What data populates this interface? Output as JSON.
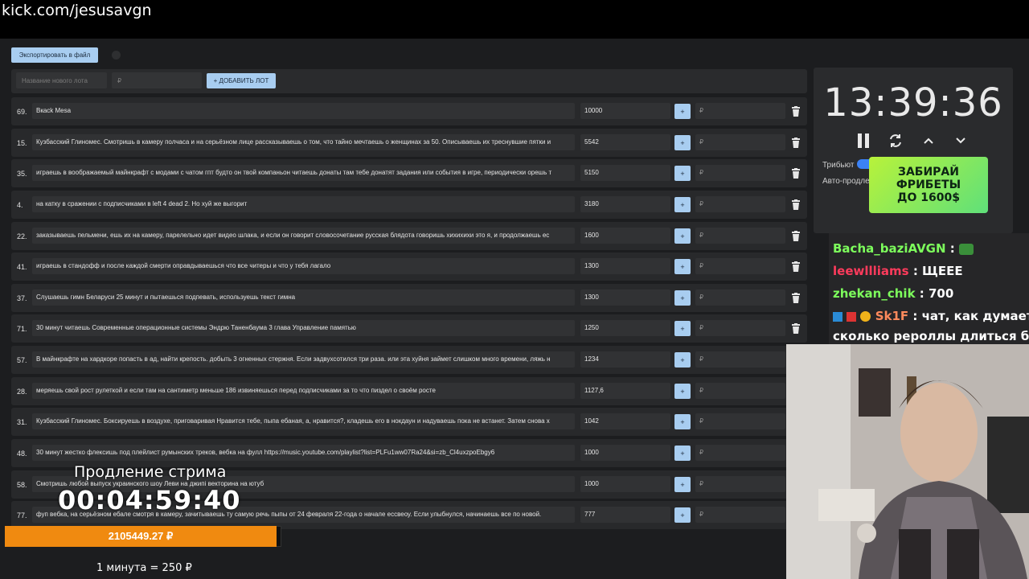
{
  "browser": {
    "url": "kick.com/jesusavgn"
  },
  "toolbar": {
    "export_label": "Экспортировать в файл"
  },
  "add_form": {
    "name_placeholder": "Название нового лота",
    "amount_placeholder": "₽",
    "add_label": "+ ДОБАВИТЬ ЛОТ"
  },
  "lots": [
    {
      "num": "69.",
      "title": "Bкack Mesa",
      "amount": "10000",
      "plus": "+",
      "add": "₽"
    },
    {
      "num": "15.",
      "title": "Кузбасский Глиномес. Смотришь в камеру полчаса и на серьёзном лице рассказываешь о том, что тайно мечтаешь о женщинах за 50. Описываешь их треснувшие пятки и",
      "amount": "5542",
      "plus": "+",
      "add": "₽"
    },
    {
      "num": "35.",
      "title": "играешь в воображаемый майнкрафт с модами с чатом гпт будто он твой компаньон читаешь донаты там тебе донатят задания или события в игре, периодически орешь т",
      "amount": "5150",
      "plus": "+",
      "add": "₽"
    },
    {
      "num": "4.",
      "title": "на катку в сражении с подписчиками в left 4 dead 2. Но хуй же выгорит",
      "amount": "3180",
      "plus": "+",
      "add": "₽"
    },
    {
      "num": "22.",
      "title": "заказываешь пельмени, ешь их на камеру, парелельно идет видео шлака, и если он говорит словосочетание русская блядота говоришь хихихихи это я, и продолжаешь ес",
      "amount": "1600",
      "plus": "+",
      "add": "₽"
    },
    {
      "num": "41.",
      "title": "играешь в стандофф и после каждой смерти оправдываешься что все читеры и что у тебя лагало",
      "amount": "1300",
      "plus": "+",
      "add": "₽"
    },
    {
      "num": "37.",
      "title": "Слушаешь гимн Беларуси 25 минут и пытаешься подпевать, используешь текст гимна",
      "amount": "1300",
      "plus": "+",
      "add": "₽"
    },
    {
      "num": "71.",
      "title": "30 минут читаешь Современные операционные системы Эндрю Таненбаума 3 глава Управление памятью",
      "amount": "1250",
      "plus": "+",
      "add": "₽"
    },
    {
      "num": "57.",
      "title": "В майнкрафте на хардкоре попасть в ад, найти крепость. добыть 3 огненных стержня. Если задвухсотился три раза. или эта хуйня займет слишком много времени, ляжь н",
      "amount": "1234",
      "plus": "+",
      "add": "₽"
    },
    {
      "num": "28.",
      "title": "меряешь свой рост рулеткой и если там на сантиметр меньше 186 извиняешься перед подписчиками за то что пиздел о своём росте",
      "amount": "1127,6",
      "plus": "+",
      "add": "₽"
    },
    {
      "num": "31.",
      "title": "Кузбасский Глиномес. Боксируешь в воздухе, приговаривая Нравится тебе, пыпа ебаная, а, нравится?, кладешь его в нокдаун и надуваешь пока не встанет. Затем снова х",
      "amount": "1042",
      "plus": "+",
      "add": "₽"
    },
    {
      "num": "48.",
      "title": "30 минут жестко флексишь под плейлист румынских треков, вебка на фулл https://music.youtube.com/playlist?list=PLFu1ww07Ra24&si=zb_Cl4uxzpoEbgy6",
      "amount": "1000",
      "plus": "+",
      "add": "₽"
    },
    {
      "num": "58.",
      "title": "Смотришь любой выпуск украинского шоу Леви на джипі векторина на ютуб",
      "amount": "1000",
      "plus": "+",
      "add": "₽"
    },
    {
      "num": "77.",
      "title": "фуп вебка, на серьёзном ебале смотря в камеру, зачитываешь ту самую речь пыпы от 24 февраля 22-года о начале ессвеоу. Если улыбнулся, начинаешь все по новой.",
      "amount": "777",
      "plus": "+",
      "add": "₽"
    }
  ],
  "timer_panel": {
    "time": "13:39:36",
    "tribute_label": "Трибьют",
    "auto_label": "Авто-продле"
  },
  "ad": {
    "line1": "ЗАБИРАЙ",
    "line2": "ФРИБЕТЫ",
    "line3": "ДО 1600$"
  },
  "chat": [
    {
      "user": "Bacha_baziAVGN",
      "sep": " : ",
      "msg": ""
    },
    {
      "user": "leewllliams",
      "sep": " : ",
      "msg": "ЩЕЕЕ"
    },
    {
      "user": "zhekan_chik",
      "sep": " : ",
      "msg": "700"
    },
    {
      "user": "Sk1F",
      "sep": " : ",
      "msg": "чат, как думаете,",
      "msg2": "сколько рероллы длиться будут"
    }
  ],
  "overlay": {
    "title": "Продление стрима",
    "timer": "00:04:59:40",
    "total": "2105449.27 ₽",
    "rate": "1 минута = 250 ₽"
  },
  "colors": {
    "accent": "#a8cdf0",
    "progress": "#f08a10",
    "ad_green": "#7dff5c"
  }
}
